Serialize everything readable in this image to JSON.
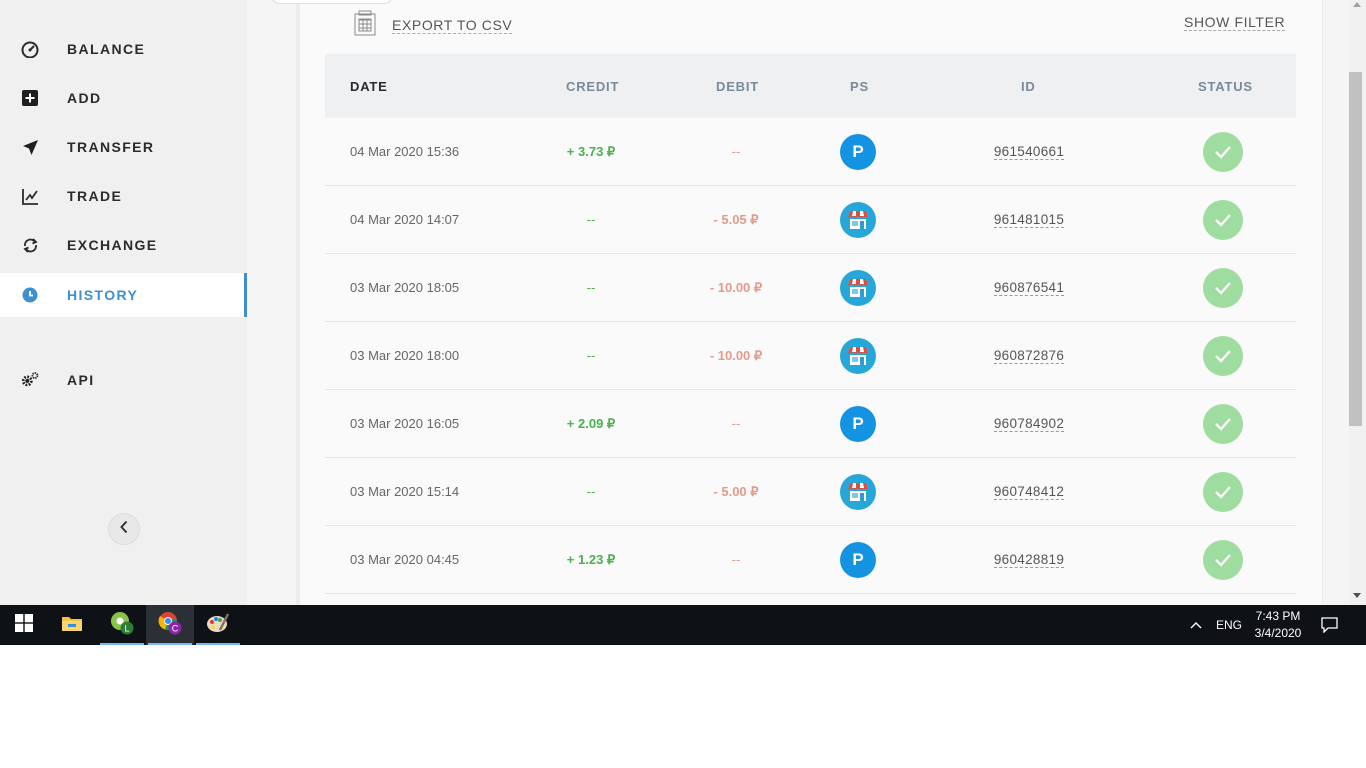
{
  "sidebar": {
    "items": [
      {
        "label": "BALANCE",
        "icon": "gauge-icon"
      },
      {
        "label": "ADD",
        "icon": "plus-square-icon"
      },
      {
        "label": "TRANSFER",
        "icon": "paper-plane-icon"
      },
      {
        "label": "TRADE",
        "icon": "line-chart-icon"
      },
      {
        "label": "EXCHANGE",
        "icon": "exchange-arrows-icon"
      },
      {
        "label": "HISTORY",
        "icon": "clock-icon",
        "active": true
      },
      {
        "label": "API",
        "icon": "gears-icon"
      }
    ],
    "collapse_icon": "chevron-left-icon"
  },
  "toolbar": {
    "export_label": "EXPORT TO CSV",
    "show_filter_label": "SHOW FILTER"
  },
  "table": {
    "headers": {
      "date": "DATE",
      "credit": "CREDIT",
      "debit": "DEBIT",
      "ps": "PS",
      "id": "ID",
      "status": "STATUS"
    },
    "rows": [
      {
        "date": "04 Mar 2020 15:36",
        "credit": "+ 3.73 ₽",
        "debit": "--",
        "ps": "P",
        "ps_type": "p-icon",
        "id": "961540661",
        "status": "success"
      },
      {
        "date": "04 Mar 2020 14:07",
        "credit": "--",
        "debit": "- 5.05 ₽",
        "ps": "",
        "ps_type": "shop-icon",
        "id": "961481015",
        "status": "success"
      },
      {
        "date": "03 Mar 2020 18:05",
        "credit": "--",
        "debit": "- 10.00 ₽",
        "ps": "",
        "ps_type": "shop-icon",
        "id": "960876541",
        "status": "success"
      },
      {
        "date": "03 Mar 2020 18:00",
        "credit": "--",
        "debit": "- 10.00 ₽",
        "ps": "",
        "ps_type": "shop-icon",
        "id": "960872876",
        "status": "success"
      },
      {
        "date": "03 Mar 2020 16:05",
        "credit": "+ 2.09 ₽",
        "debit": "--",
        "ps": "P",
        "ps_type": "p-icon",
        "id": "960784902",
        "status": "success"
      },
      {
        "date": "03 Mar 2020 15:14",
        "credit": "--",
        "debit": "- 5.00 ₽",
        "ps": "",
        "ps_type": "shop-icon",
        "id": "960748412",
        "status": "success"
      },
      {
        "date": "03 Mar 2020 04:45",
        "credit": "+ 1.23 ₽",
        "debit": "--",
        "ps": "P",
        "ps_type": "p-icon",
        "id": "960428819",
        "status": "success"
      }
    ]
  },
  "colors": {
    "accent": "#3d8fd0",
    "credit": "#4caf50",
    "debit": "#e29b8e",
    "status_ok": "#9fdc9f",
    "ps_p": "#1493e2",
    "ps_shop": "#27a7d8"
  },
  "taskbar": {
    "apps": [
      "windows-start-icon",
      "file-explorer-icon",
      "chrome-profile-l-icon",
      "chrome-profile-c-icon",
      "paint-icon"
    ],
    "profile_l": "L",
    "profile_c": "C",
    "language": "ENG",
    "time": "7:43 PM",
    "date": "3/4/2020"
  }
}
